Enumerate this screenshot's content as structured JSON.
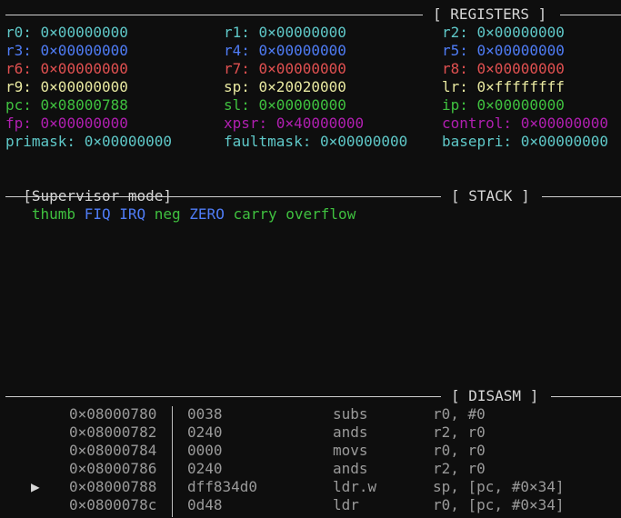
{
  "registers_header": "[ REGISTERS ]",
  "stack_header": "[ STACK ]",
  "disasm_header": "[ DISASM ]",
  "colors": {
    "cyan": "#5fc8c8",
    "blue": "#4f7cf5",
    "red": "#e05050",
    "yellow": "#e8e8a0",
    "green": "#3fc03f",
    "magenta": "#b01fb0",
    "gray": "#9a9a9a"
  },
  "registers": [
    {
      "name": "r0:",
      "value": "0×00000000",
      "color": "cyan"
    },
    {
      "name": "r1:",
      "value": "0×00000000",
      "color": "cyan"
    },
    {
      "name": "r2:",
      "value": "0×00000000",
      "color": "cyan"
    },
    {
      "name": "r3:",
      "value": "0×00000000",
      "color": "blue"
    },
    {
      "name": "r4:",
      "value": "0×00000000",
      "color": "blue"
    },
    {
      "name": "r5:",
      "value": "0×00000000",
      "color": "blue"
    },
    {
      "name": "r6:",
      "value": "0×00000000",
      "color": "red"
    },
    {
      "name": "r7:",
      "value": "0×00000000",
      "color": "red"
    },
    {
      "name": "r8:",
      "value": "0×00000000",
      "color": "red"
    },
    {
      "name": "r9:",
      "value": "0×00000000",
      "color": "yellow"
    },
    {
      "name": "sp:",
      "value": "0×20020000",
      "color": "yellow"
    },
    {
      "name": "lr:",
      "value": "0×ffffffff",
      "color": "yellow"
    },
    {
      "name": "pc:",
      "value": "0×08000788",
      "color": "green"
    },
    {
      "name": "sl:",
      "value": "0×00000000",
      "color": "green"
    },
    {
      "name": "ip:",
      "value": "0×00000000",
      "color": "green"
    },
    {
      "name": "fp:",
      "value": "0×00000000",
      "color": "magenta"
    },
    {
      "name": "xpsr:",
      "value": "0×40000000",
      "color": "magenta"
    },
    {
      "name": "control:",
      "value": "0×00000000",
      "color": "magenta"
    },
    {
      "name": "primask:",
      "value": "0×00000000",
      "color": "cyan"
    },
    {
      "name": "faultmask:",
      "value": "0×00000000",
      "color": "cyan"
    },
    {
      "name": "basepri:",
      "value": "0×00000000",
      "color": "cyan"
    }
  ],
  "mode_line": {
    "mode": "[Supervisor mode]",
    "flags": [
      {
        "text": "thumb",
        "color": "green"
      },
      {
        "text": "FIQ",
        "color": "blue"
      },
      {
        "text": "IRQ",
        "color": "blue"
      },
      {
        "text": "neg",
        "color": "green"
      },
      {
        "text": "ZERO",
        "color": "blue"
      },
      {
        "text": "carry",
        "color": "green"
      },
      {
        "text": "overflow",
        "color": "green"
      }
    ]
  },
  "disasm": [
    {
      "marker": "",
      "addr": "0×08000780",
      "bytes": "0038",
      "mnemonic": "subs",
      "operands": "r0, #0"
    },
    {
      "marker": "",
      "addr": "0×08000782",
      "bytes": "0240",
      "mnemonic": "ands",
      "operands": "r2, r0"
    },
    {
      "marker": "",
      "addr": "0×08000784",
      "bytes": "0000",
      "mnemonic": "movs",
      "operands": "r0, r0"
    },
    {
      "marker": "",
      "addr": "0×08000786",
      "bytes": "0240",
      "mnemonic": "ands",
      "operands": "r2, r0"
    },
    {
      "marker": "▶",
      "addr": "0×08000788",
      "bytes": "dff834d0",
      "mnemonic": "ldr.w",
      "operands": "sp, [pc, #0×34]"
    },
    {
      "marker": "",
      "addr": "0×0800078c",
      "bytes": "0d48",
      "mnemonic": "ldr",
      "operands": "r0, [pc, #0×34]"
    }
  ]
}
